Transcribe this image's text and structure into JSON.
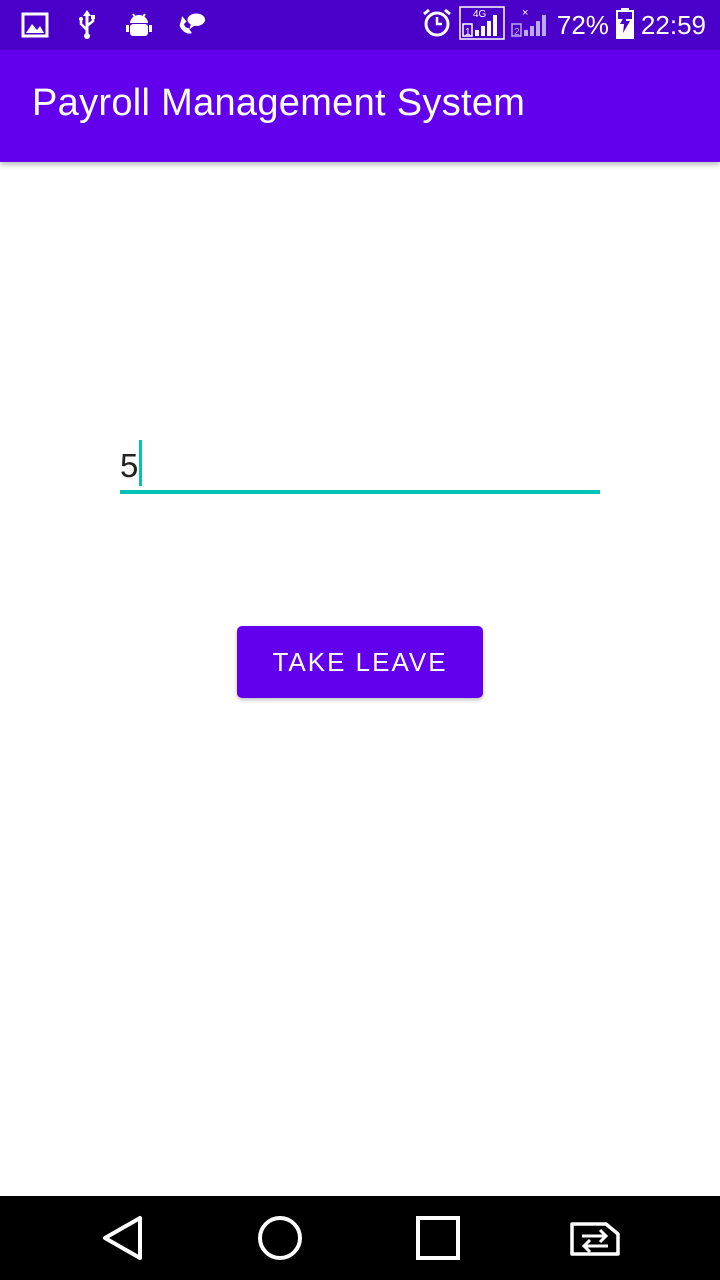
{
  "status_bar": {
    "battery_percent": "72%",
    "time": "22:59",
    "network_label": "4G",
    "icons": [
      "image-icon",
      "usb-icon",
      "android-debug-icon",
      "chat-icon",
      "alarm-icon",
      "signal-sim1-icon",
      "signal-sim2-icon",
      "battery-charging-icon"
    ]
  },
  "app_bar": {
    "title": "Payroll Management System"
  },
  "form": {
    "leave_value": "5",
    "button_label": "TAKE LEAVE"
  },
  "nav_bar": {
    "icons": [
      "back-icon",
      "home-icon",
      "recents-icon",
      "sim-switch-icon"
    ]
  },
  "colors": {
    "status_bar": "#4a00c8",
    "app_bar": "#6200ee",
    "accent": "#03c4b4",
    "button": "#6200ee"
  }
}
